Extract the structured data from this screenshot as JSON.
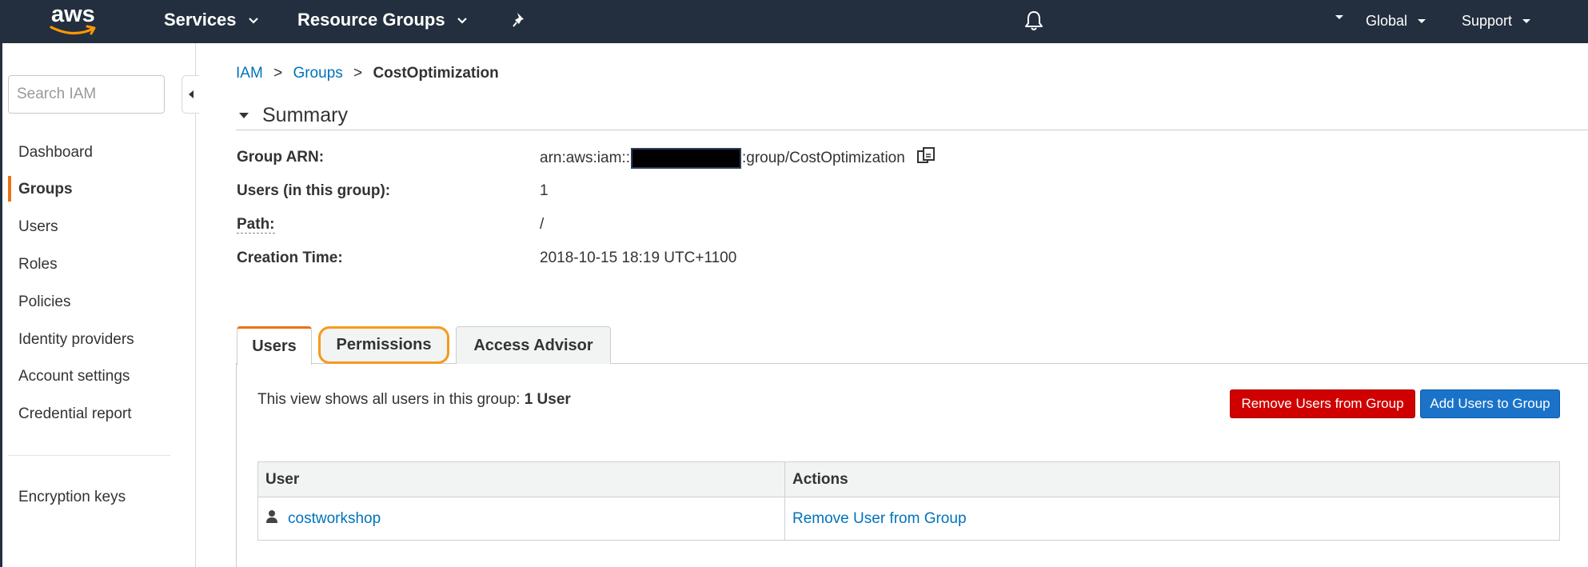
{
  "nav": {
    "logo_text": "aws",
    "services": "Services",
    "resource_groups": "Resource Groups",
    "region": "Global",
    "support": "Support"
  },
  "sidebar": {
    "search_placeholder": "Search IAM",
    "items": [
      {
        "label": "Dashboard"
      },
      {
        "label": "Groups",
        "active": true
      },
      {
        "label": "Users"
      },
      {
        "label": "Roles"
      },
      {
        "label": "Policies"
      },
      {
        "label": "Identity providers"
      },
      {
        "label": "Account settings"
      },
      {
        "label": "Credential report"
      },
      {
        "label": "Encryption keys"
      }
    ]
  },
  "breadcrumb": {
    "items": [
      "IAM",
      "Groups"
    ],
    "separator": ">",
    "current": "CostOptimization"
  },
  "summary": {
    "title": "Summary",
    "rows": [
      {
        "label": "Group ARN:",
        "value_prefix": "arn:aws:iam::",
        "value_suffix": ":group/CostOptimization"
      },
      {
        "label": "Users (in this group):",
        "value": "1"
      },
      {
        "label": "Path:",
        "value": "/"
      },
      {
        "label": "Creation Time:",
        "value": "2018-10-15 18:19 UTC+1100"
      }
    ]
  },
  "tabs": [
    {
      "label": "Users",
      "active": true
    },
    {
      "label": "Permissions",
      "highlighted": true
    },
    {
      "label": "Access Advisor"
    }
  ],
  "users_panel": {
    "description": "This view shows all users in this group:",
    "count_text": "1 User",
    "remove_button": "Remove Users from Group",
    "add_button": "Add Users to Group",
    "table": {
      "headers": [
        "User",
        "Actions"
      ],
      "rows": [
        {
          "user": "costworkshop",
          "action": "Remove User from Group"
        }
      ]
    }
  },
  "colors": {
    "nav_bg": "#232f3e",
    "accent_orange": "#ec7211",
    "link_blue": "#0073bb",
    "danger_red": "#d00000",
    "primary_blue": "#1a73c9"
  },
  "icons": [
    "caret-down-icon",
    "pin-icon",
    "bell-icon",
    "collapse-left-icon",
    "caret-expanded-icon",
    "copy-icon",
    "user-icon"
  ]
}
